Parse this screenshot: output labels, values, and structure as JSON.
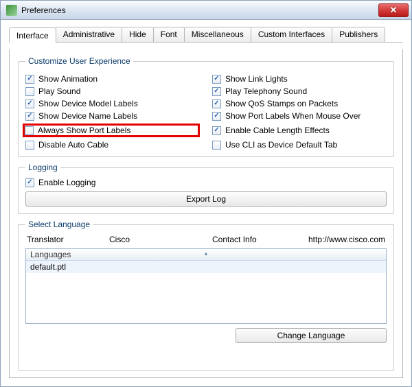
{
  "window": {
    "title": "Preferences"
  },
  "tabs": [
    {
      "label": "Interface"
    },
    {
      "label": "Administrative"
    },
    {
      "label": "Hide"
    },
    {
      "label": "Font"
    },
    {
      "label": "Miscellaneous"
    },
    {
      "label": "Custom Interfaces"
    },
    {
      "label": "Publishers"
    }
  ],
  "groups": {
    "ux": {
      "title": "Customize User Experience",
      "left": [
        {
          "label": "Show Animation",
          "checked": true
        },
        {
          "label": "Play Sound",
          "checked": false
        },
        {
          "label": "Show Device Model Labels",
          "checked": true
        },
        {
          "label": "Show Device Name Labels",
          "checked": true
        },
        {
          "label": "Always Show Port Labels",
          "checked": false,
          "highlight": true
        },
        {
          "label": "Disable Auto Cable",
          "checked": false
        }
      ],
      "right": [
        {
          "label": "Show Link Lights",
          "checked": true
        },
        {
          "label": "Play Telephony Sound",
          "checked": true
        },
        {
          "label": "Show QoS Stamps on Packets",
          "checked": true
        },
        {
          "label": "Show Port Labels When Mouse Over",
          "checked": true
        },
        {
          "label": "Enable Cable Length Effects",
          "checked": true
        },
        {
          "label": "Use CLI as Device Default Tab",
          "checked": false
        }
      ]
    },
    "logging": {
      "title": "Logging",
      "enable": {
        "label": "Enable Logging",
        "checked": true
      },
      "export_btn": "Export Log"
    },
    "language": {
      "title": "Select Language",
      "headers": {
        "translator": "Translator",
        "translator_value": "Cisco",
        "contact": "Contact Info",
        "contact_value": "http://www.cisco.com"
      },
      "list_header": "Languages",
      "items": [
        "default.ptl"
      ],
      "change_btn": "Change Language"
    }
  }
}
